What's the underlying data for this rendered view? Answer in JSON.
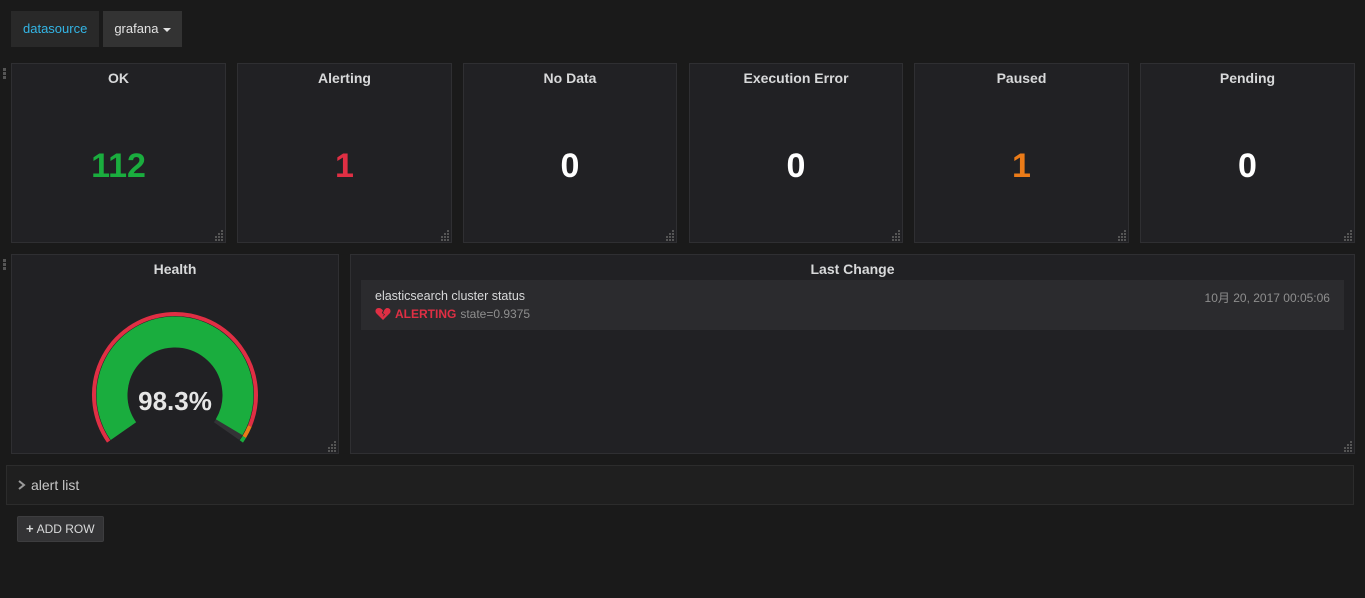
{
  "template_variable": {
    "label": "datasource",
    "selected_value": "grafana"
  },
  "stat_panels": [
    {
      "title": "OK",
      "value": "112",
      "color": "#1aad3e"
    },
    {
      "title": "Alerting",
      "value": "1",
      "color": "#e02f44"
    },
    {
      "title": "No Data",
      "value": "0",
      "color": "#ffffff"
    },
    {
      "title": "Execution Error",
      "value": "0",
      "color": "#ffffff"
    },
    {
      "title": "Paused",
      "value": "1",
      "color": "#eb7b18"
    },
    {
      "title": "Pending",
      "value": "0",
      "color": "#ffffff"
    }
  ],
  "health_panel": {
    "title": "Health",
    "value_text": "98.3%",
    "value": 98.3,
    "gauge_fill_color": "#1aad3e",
    "threshold_colors": [
      "#e02f44",
      "#eb7b18",
      "#1aad3e"
    ]
  },
  "last_change_panel": {
    "title": "Last Change",
    "items": [
      {
        "name": "elasticsearch cluster status",
        "state": "ALERTING",
        "info": "state=0.9375",
        "time": "10月 20, 2017 00:05:06",
        "icon": "broken-heart-icon"
      }
    ]
  },
  "collapsed_row": {
    "title": "alert list",
    "icon": "chevron-right-icon"
  },
  "add_row_button": {
    "label": "ADD ROW",
    "icon": "plus-icon"
  }
}
